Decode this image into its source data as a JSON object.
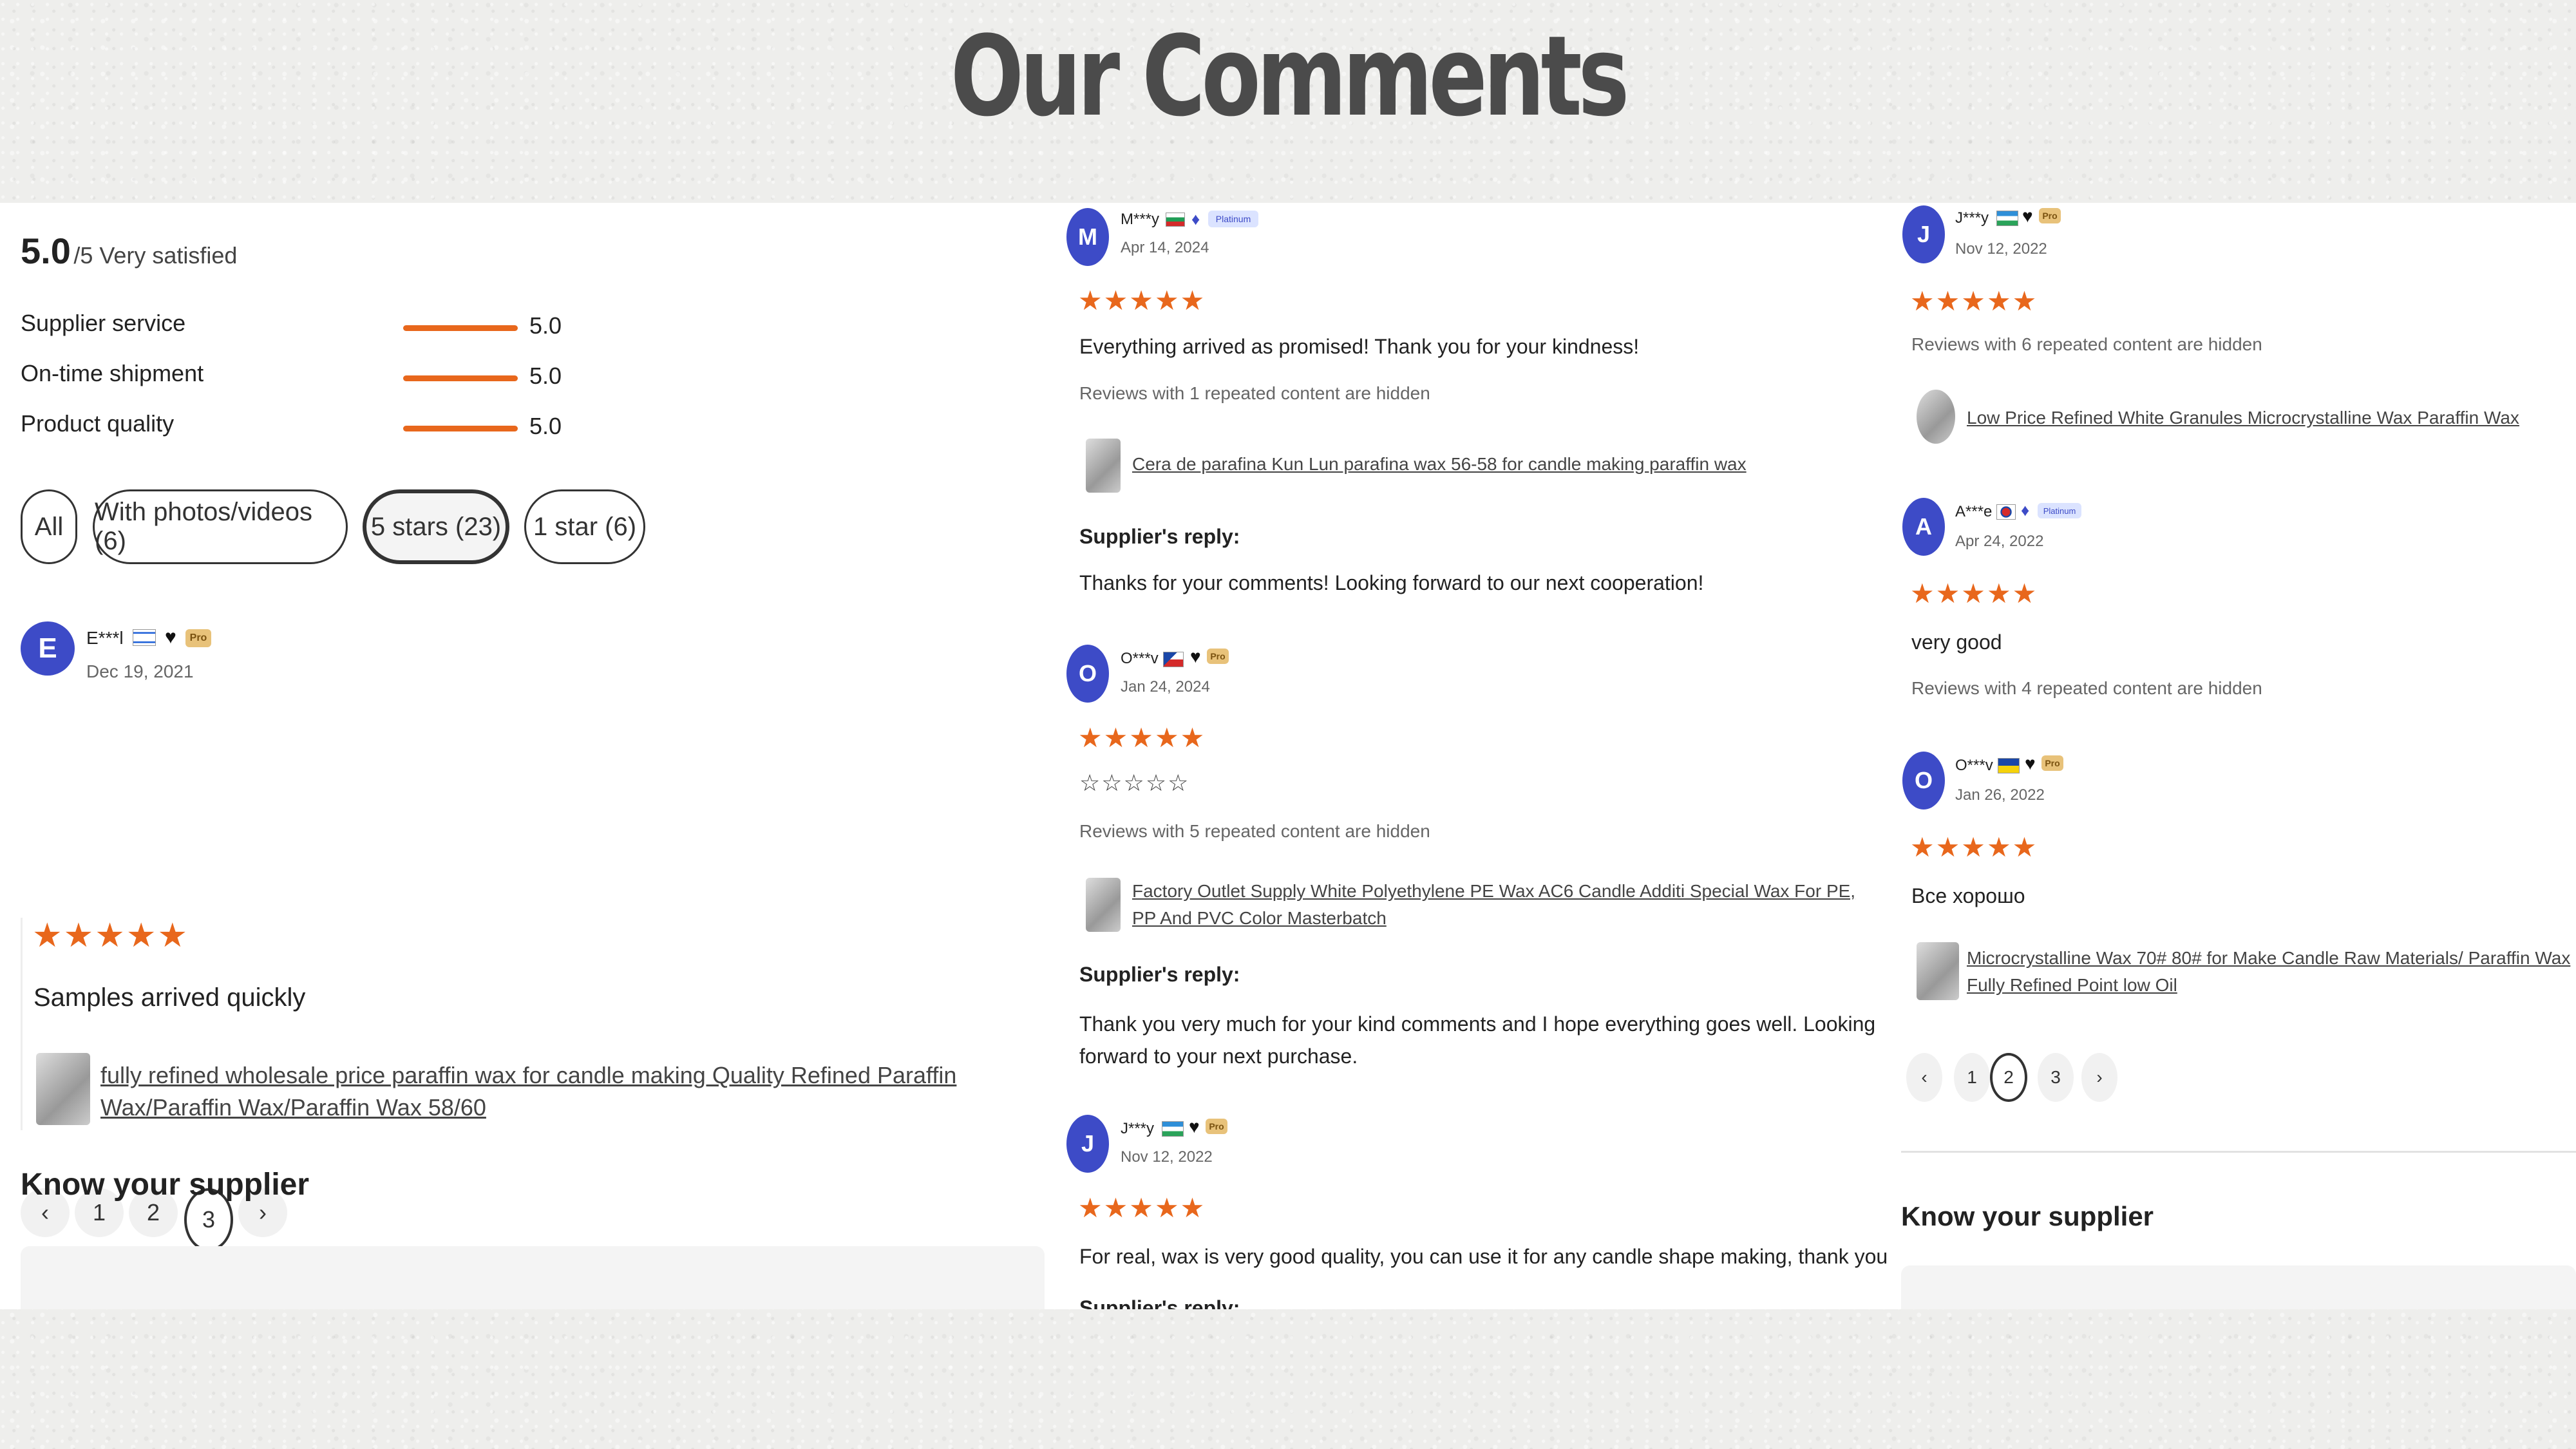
{
  "heading": "Our Comments",
  "colors": {
    "accent": "#e8671c",
    "avatar": "#3d4bc7"
  },
  "summary": {
    "score": "5.0",
    "suffix": "/5 Very satisfied",
    "metrics": [
      {
        "label": "Supplier service",
        "value": "5.0",
        "level": 1.0
      },
      {
        "label": "On-time shipment",
        "value": "5.0",
        "level": 1.0
      },
      {
        "label": "Product quality",
        "value": "5.0",
        "level": 1.0
      }
    ]
  },
  "filters": [
    "All",
    "With photos/videos (6)",
    "5 stars (23)",
    "1 star (6)"
  ],
  "stars": "★★★★★",
  "empty_stars": "☆☆☆☆☆",
  "left_review": {
    "initial": "E",
    "name": "E***l",
    "date": "Dec 19, 2021",
    "text": "Samples arrived quickly",
    "product": "fully refined wholesale price paraffin wax for candle making Quality Refined Paraffin Wax/Paraffin Wax/Paraffin Wax 58/60"
  },
  "pager_left": {
    "prev": "‹",
    "pages": [
      "1",
      "2",
      "3"
    ],
    "next": "›",
    "current": "3"
  },
  "pager_right": {
    "prev": "‹",
    "pages": [
      "1",
      "2",
      "3"
    ],
    "next": "›",
    "current": "2"
  },
  "know_supplier": "Know your supplier",
  "badges": {
    "pro": "Pro",
    "platinum": "Platinum"
  },
  "mid_reviews": [
    {
      "initial": "M",
      "name": "M***y",
      "date": "Apr 14, 2024",
      "text": "Everything arrived as promised! Thank you for your kindness!",
      "hidden": "Reviews with 1 repeated content are hidden",
      "product": "Cera de parafina Kun Lun parafina wax 56-58 for candle making paraffin wax",
      "reply_label": "Supplier's reply:",
      "reply": "Thanks for your comments! Looking forward to our next cooperation!"
    },
    {
      "initial": "O",
      "name": "O***v",
      "date": "Jan 24, 2024",
      "hidden": "Reviews with 5 repeated content are hidden",
      "product": "Factory Outlet Supply White Polyethylene PE Wax AC6 Candle Additi Special Wax For PE, PP And PVC Color Masterbatch",
      "reply_label": "Supplier's reply:",
      "reply": "Thank you very much for your kind comments and I hope everything goes well. Looking forward to your next purchase."
    },
    {
      "initial": "J",
      "name": "J***y",
      "date": "Nov 12, 2022",
      "text": "For real, wax is very good quality, you can use it for any candle shape making, thank you for your service",
      "reply_label": "Supplier's reply:"
    }
  ],
  "right_reviews": [
    {
      "initial": "J",
      "name": "J***y",
      "date": "Nov 12, 2022",
      "hidden": "Reviews with 6 repeated content are hidden",
      "product": "Low Price Refined White Granules Microcrystalline Wax Paraffin Wax"
    },
    {
      "initial": "A",
      "name": "A***e",
      "date": "Apr 24, 2022",
      "text": "very good",
      "hidden": "Reviews with 4 repeated content are hidden"
    },
    {
      "initial": "O",
      "name": "O***v",
      "date": "Jan 26, 2022",
      "text": "Все хорошо",
      "product": "Microcrystalline Wax 70# 80# for Make Candle Raw Materials/ Paraffin Wax Fully Refined Point low Oil"
    }
  ]
}
